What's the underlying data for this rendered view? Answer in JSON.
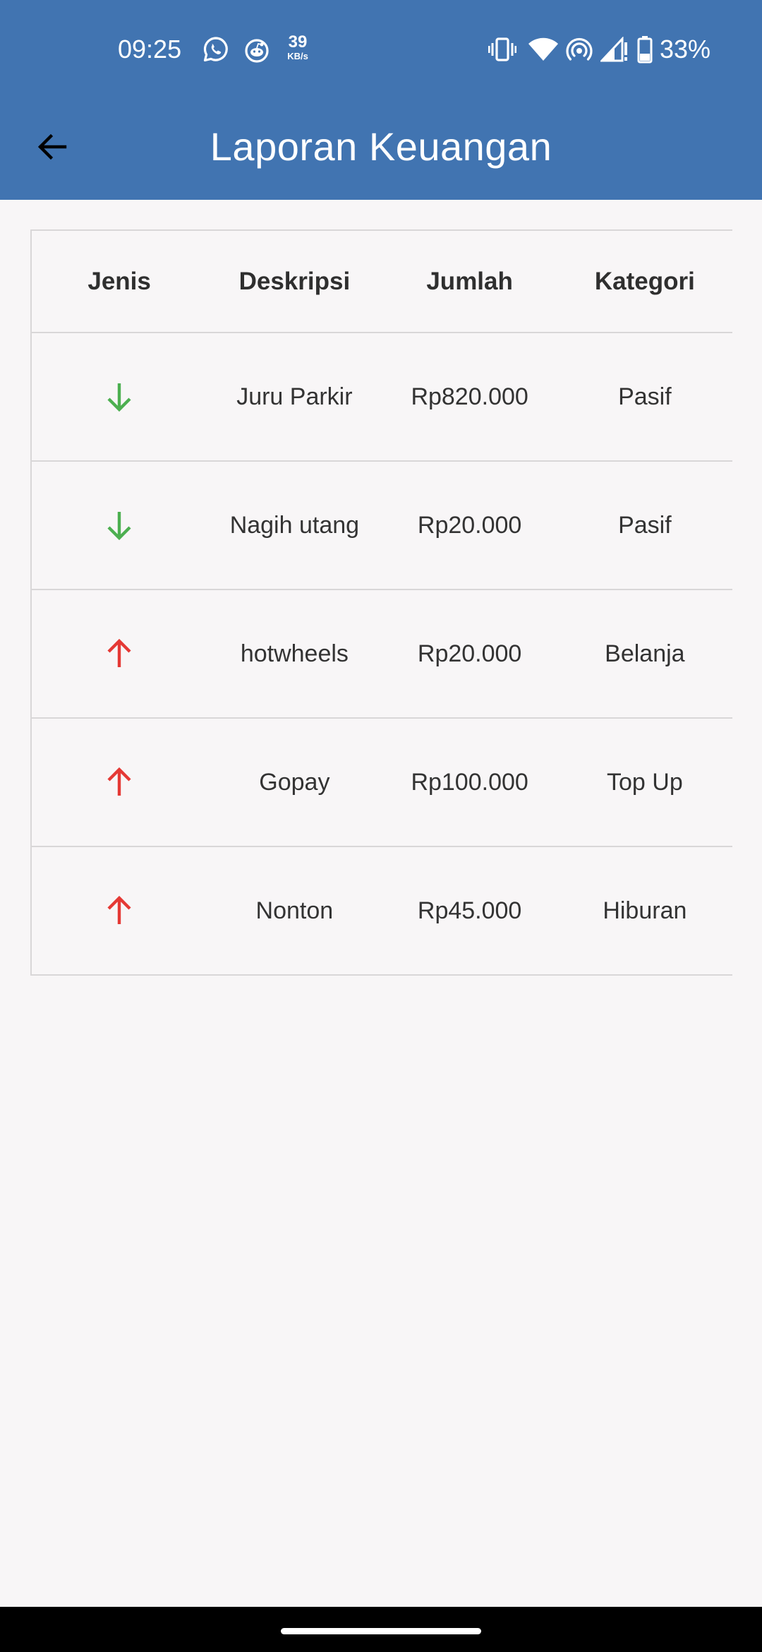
{
  "status_bar": {
    "time": "09:25",
    "net_speed_value": "39",
    "net_speed_unit": "KB/s",
    "battery": "33%",
    "icons": [
      "whatsapp-icon",
      "reddit-icon",
      "vibrate-icon",
      "wifi-icon",
      "hotspot-icon",
      "signal-icon",
      "battery-icon"
    ]
  },
  "app_bar": {
    "title": "Laporan Keuangan",
    "back_icon": "arrow-back-icon",
    "background": "#4174B1"
  },
  "table": {
    "headers": [
      "Jenis",
      "Deskripsi",
      "Jumlah",
      "Kategori"
    ],
    "rows": [
      {
        "jenis": "income",
        "icon": "arrow-down-icon",
        "color": "#4CAF50",
        "deskripsi": "Juru Parkir",
        "jumlah": "Rp820.000",
        "kategori": "Pasif"
      },
      {
        "jenis": "income",
        "icon": "arrow-down-icon",
        "color": "#4CAF50",
        "deskripsi": "Nagih utang",
        "jumlah": "Rp20.000",
        "kategori": "Pasif"
      },
      {
        "jenis": "expense",
        "icon": "arrow-up-icon",
        "color": "#E53935",
        "deskripsi": "hotwheels",
        "jumlah": "Rp20.000",
        "kategori": "Belanja"
      },
      {
        "jenis": "expense",
        "icon": "arrow-up-icon",
        "color": "#E53935",
        "deskripsi": "Gopay",
        "jumlah": "Rp100.000",
        "kategori": "Top Up"
      },
      {
        "jenis": "expense",
        "icon": "arrow-up-icon",
        "color": "#E53935",
        "deskripsi": "Nonton",
        "jumlah": "Rp45.000",
        "kategori": "Hiburan"
      }
    ]
  }
}
